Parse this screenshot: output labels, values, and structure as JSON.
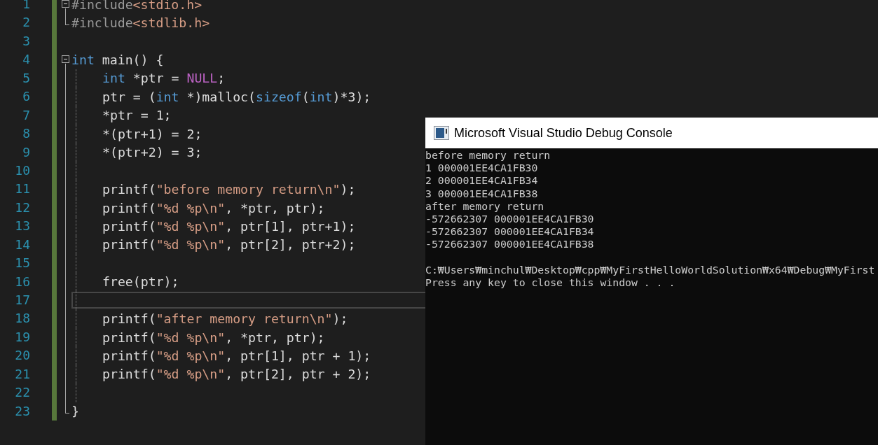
{
  "editor": {
    "lines": [
      {
        "number": "1",
        "kind": "start",
        "current": false,
        "tokens": [
          {
            "text": "#include",
            "kind": "preproc"
          },
          {
            "text": "<stdio.h>",
            "kind": "string"
          }
        ]
      },
      {
        "number": "2",
        "kind": "end",
        "current": false,
        "tokens": [
          {
            "text": "#include",
            "kind": "preproc"
          },
          {
            "text": "<stdlib.h>",
            "kind": "string"
          }
        ]
      },
      {
        "number": "3",
        "kind": "none",
        "current": false
      },
      {
        "number": "4",
        "kind": "start",
        "current": false,
        "tokens": [
          {
            "text": "int",
            "kind": "keyword"
          },
          {
            "text": " main() {",
            "kind": "plain"
          }
        ]
      },
      {
        "number": "5",
        "kind": "inside",
        "current": false,
        "tokens": [
          {
            "text": "int",
            "kind": "keyword"
          },
          {
            "text": " *ptr = ",
            "kind": "plain"
          },
          {
            "text": "NULL",
            "kind": "macro"
          },
          {
            "text": ";",
            "kind": "plain"
          }
        ]
      },
      {
        "number": "6",
        "kind": "inside",
        "current": false,
        "tokens": [
          {
            "text": "ptr = (",
            "kind": "plain"
          },
          {
            "text": "int",
            "kind": "keyword"
          },
          {
            "text": " *)malloc(",
            "kind": "plain"
          },
          {
            "text": "sizeof",
            "kind": "keyword"
          },
          {
            "text": "(",
            "kind": "plain"
          },
          {
            "text": "int",
            "kind": "keyword"
          },
          {
            "text": ")*3);",
            "kind": "plain"
          }
        ]
      },
      {
        "number": "7",
        "kind": "inside",
        "current": false,
        "tokens": [
          {
            "text": "*ptr = 1;",
            "kind": "plain"
          }
        ]
      },
      {
        "number": "8",
        "kind": "inside",
        "current": false,
        "tokens": [
          {
            "text": "*(ptr+1) = 2;",
            "kind": "plain"
          }
        ]
      },
      {
        "number": "9",
        "kind": "inside",
        "current": false,
        "tokens": [
          {
            "text": "*(ptr+2) = 3;",
            "kind": "plain"
          }
        ]
      },
      {
        "number": "10",
        "kind": "inside",
        "current": false
      },
      {
        "number": "11",
        "kind": "inside",
        "current": false,
        "tokens": [
          {
            "text": "printf(",
            "kind": "plain"
          },
          {
            "text": "\"before memory return\\n\"",
            "kind": "string"
          },
          {
            "text": ");",
            "kind": "plain"
          }
        ]
      },
      {
        "number": "12",
        "kind": "inside",
        "current": false,
        "tokens": [
          {
            "text": "printf(",
            "kind": "plain"
          },
          {
            "text": "\"%d %p\\n\"",
            "kind": "string"
          },
          {
            "text": ", *ptr, ptr);",
            "kind": "plain"
          }
        ]
      },
      {
        "number": "13",
        "kind": "inside",
        "current": false,
        "tokens": [
          {
            "text": "printf(",
            "kind": "plain"
          },
          {
            "text": "\"%d %p\\n\"",
            "kind": "string"
          },
          {
            "text": ", ptr[1], ptr+1);",
            "kind": "plain"
          }
        ]
      },
      {
        "number": "14",
        "kind": "inside",
        "current": false,
        "tokens": [
          {
            "text": "printf(",
            "kind": "plain"
          },
          {
            "text": "\"%d %p\\n\"",
            "kind": "string"
          },
          {
            "text": ", ptr[2], ptr+2);",
            "kind": "plain"
          }
        ]
      },
      {
        "number": "15",
        "kind": "inside",
        "current": false
      },
      {
        "number": "16",
        "kind": "inside",
        "current": false,
        "tokens": [
          {
            "text": "free(ptr);",
            "kind": "plain"
          }
        ]
      },
      {
        "number": "17",
        "kind": "inside",
        "current": true
      },
      {
        "number": "18",
        "kind": "inside",
        "current": false,
        "tokens": [
          {
            "text": "printf(",
            "kind": "plain"
          },
          {
            "text": "\"after memory return\\n\"",
            "kind": "string"
          },
          {
            "text": ");",
            "kind": "plain"
          }
        ]
      },
      {
        "number": "19",
        "kind": "inside",
        "current": false,
        "tokens": [
          {
            "text": "printf(",
            "kind": "plain"
          },
          {
            "text": "\"%d %p\\n\"",
            "kind": "string"
          },
          {
            "text": ", *ptr, ptr);",
            "kind": "plain"
          }
        ]
      },
      {
        "number": "20",
        "kind": "inside",
        "current": false,
        "tokens": [
          {
            "text": "printf(",
            "kind": "plain"
          },
          {
            "text": "\"%d %p\\n\"",
            "kind": "string"
          },
          {
            "text": ", ptr[1], ptr + 1);",
            "kind": "plain"
          }
        ]
      },
      {
        "number": "21",
        "kind": "inside",
        "current": false,
        "tokens": [
          {
            "text": "printf(",
            "kind": "plain"
          },
          {
            "text": "\"%d %p\\n\"",
            "kind": "string"
          },
          {
            "text": ", ptr[2], ptr + 2);",
            "kind": "plain"
          }
        ]
      },
      {
        "number": "22",
        "kind": "inside",
        "current": false
      },
      {
        "number": "23",
        "kind": "end",
        "current": false,
        "tokens": [
          {
            "text": "}",
            "kind": "plain"
          }
        ]
      }
    ]
  },
  "console": {
    "title": "Microsoft Visual Studio Debug Console",
    "output_lines": [
      "before memory return",
      "1 000001EE4CA1FB30",
      "2 000001EE4CA1FB34",
      "3 000001EE4CA1FB38",
      "after memory return",
      "-572662307 000001EE4CA1FB30",
      "-572662307 000001EE4CA1FB34",
      "-572662307 000001EE4CA1FB38"
    ],
    "prompt_lines": [
      "C:₩Users₩minchul₩Desktop₩cpp₩MyFirstHelloWorldSolution₩x64₩Debug₩MyFirst",
      "Press any key to close this window . . ."
    ]
  }
}
